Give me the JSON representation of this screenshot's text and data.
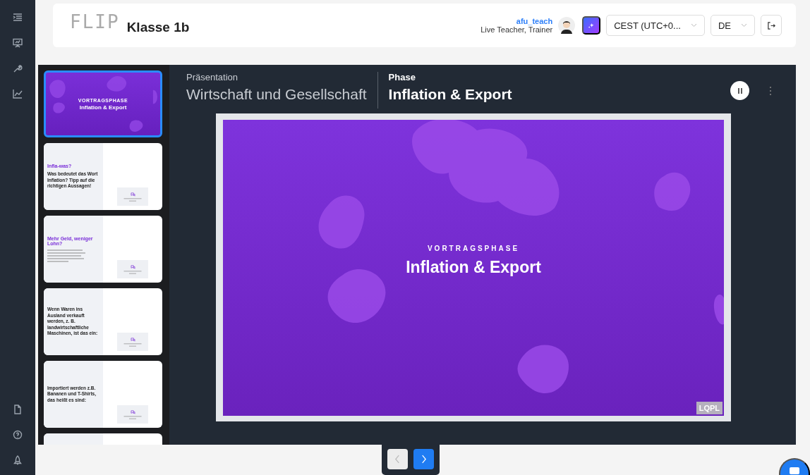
{
  "header": {
    "logo": "FLIP",
    "class_name": "Klasse 1b",
    "user": {
      "name": "afu_teach",
      "role": "Live Teacher, Trainer"
    },
    "timezone": {
      "value": "CEST (UTC+0..."
    },
    "language": {
      "value": "DE"
    }
  },
  "thumbnails": [
    {
      "kind": "title",
      "eyebrow": "VORTRAGSPHASE",
      "title": "Inflation & Export",
      "selected": true
    },
    {
      "kind": "question",
      "title": "Infla-was?",
      "text": "Was bedeutet das Wort Inflation? Tipp auf die richtigen Aussagen!",
      "selected": false
    },
    {
      "kind": "info",
      "title": "Mehr Geld, weniger Lohn?",
      "selected": false
    },
    {
      "kind": "question",
      "text": "Wenn Waren ins Ausland verkauft werden, z. B. landwirtschaftliche Maschinen, ist das ein:",
      "selected": false
    },
    {
      "kind": "question",
      "text": "Importiert werden z.B. Bananen und T-Shirts, das heißt es sind:",
      "selected": false
    },
    {
      "kind": "partial",
      "selected": false
    }
  ],
  "presentation": {
    "label": "Präsentation",
    "title": "Wirtschaft und Gesellschaft"
  },
  "phase": {
    "label": "Phase",
    "title": "Inflation & Export"
  },
  "slide": {
    "eyebrow": "VORTRAGSPHASE",
    "title": "Inflation & Export",
    "badge": "LQPL"
  },
  "nav": {
    "prev": {
      "disabled": true
    },
    "next": {
      "disabled": false
    }
  }
}
